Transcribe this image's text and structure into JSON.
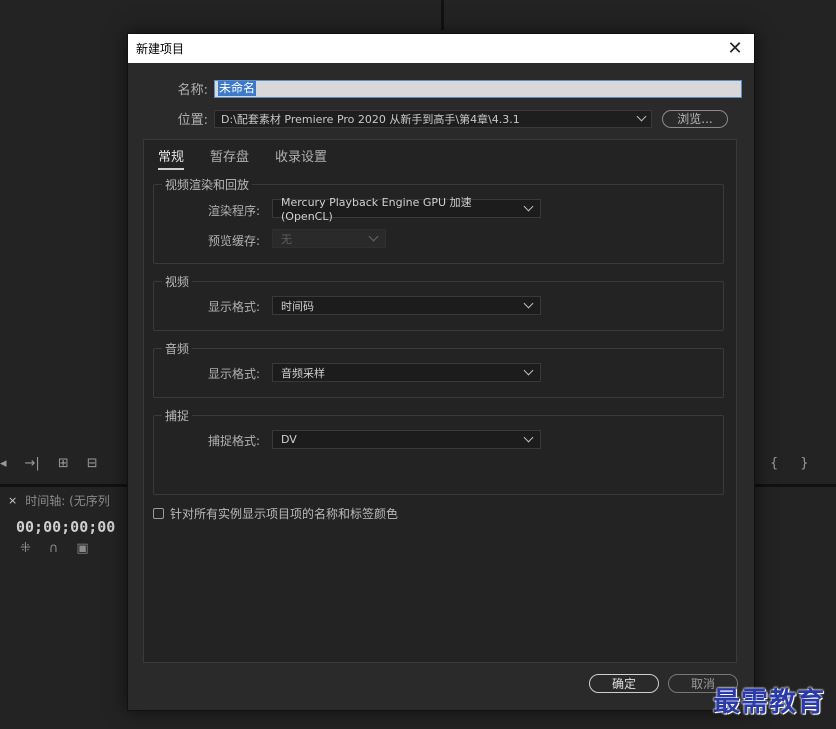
{
  "background": {
    "timeline_tab_label": "时间轴: (无序列",
    "timeline_close": "×",
    "timecode": "00;00;00;00",
    "tool_icons_left": [
      "◂",
      "→|",
      "⊞",
      "⊟"
    ],
    "tool_icons_right": [
      "{",
      "}"
    ],
    "timeline_icons": [
      "⁜",
      "∩",
      "▣"
    ]
  },
  "dialog": {
    "title": "新建项目",
    "close_glyph": "✕",
    "name_label": "名称:",
    "name_value": "未命名",
    "location_label": "位置:",
    "location_value": "D:\\配套素材 Premiere Pro 2020 从新手到高手\\第4章\\4.3.1",
    "browse_label": "浏览...",
    "tabs": [
      "常规",
      "暂存盘",
      "收录设置"
    ],
    "groups": {
      "render": {
        "title": "视频渲染和回放",
        "renderer_label": "渲染程序:",
        "renderer_value": "Mercury Playback Engine GPU 加速 (OpenCL)",
        "preview_cache_label": "预览缓存:",
        "preview_cache_value": "无"
      },
      "video": {
        "title": "视频",
        "display_format_label": "显示格式:",
        "display_format_value": "时间码"
      },
      "audio": {
        "title": "音频",
        "display_format_label": "显示格式:",
        "display_format_value": "音频采样"
      },
      "capture": {
        "title": "捕捉",
        "capture_format_label": "捕捉格式:",
        "capture_format_value": "DV"
      }
    },
    "checkbox_label": "针对所有实例显示项目项的名称和标签颜色",
    "ok_label": "确定",
    "cancel_label": "取消"
  },
  "watermark": "最需教育"
}
